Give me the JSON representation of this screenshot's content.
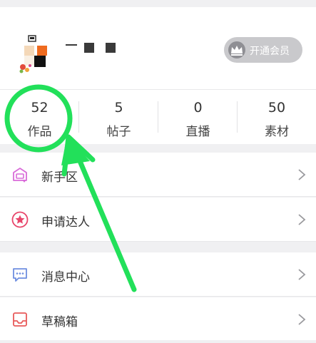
{
  "profile": {
    "vip_button_label": "开通会员"
  },
  "stats": [
    {
      "value": "52",
      "label": "作品"
    },
    {
      "value": "5",
      "label": "帖子"
    },
    {
      "value": "0",
      "label": "直播"
    },
    {
      "value": "50",
      "label": "素材"
    }
  ],
  "menu": {
    "group1": [
      {
        "label": "新手区",
        "icon": "newbie-zone-icon"
      },
      {
        "label": "申请达人",
        "icon": "star-badge-icon"
      }
    ],
    "group2": [
      {
        "label": "消息中心",
        "icon": "message-bubble-icon"
      },
      {
        "label": "草稿箱",
        "icon": "drafts-tray-icon"
      }
    ]
  },
  "annotation": {
    "color": "#22e05a"
  },
  "colors": {
    "newbie_icon": "#d96bd9",
    "star_icon": "#e8456a",
    "message_icon": "#6f8fe0",
    "drafts_icon": "#e85a5a"
  }
}
